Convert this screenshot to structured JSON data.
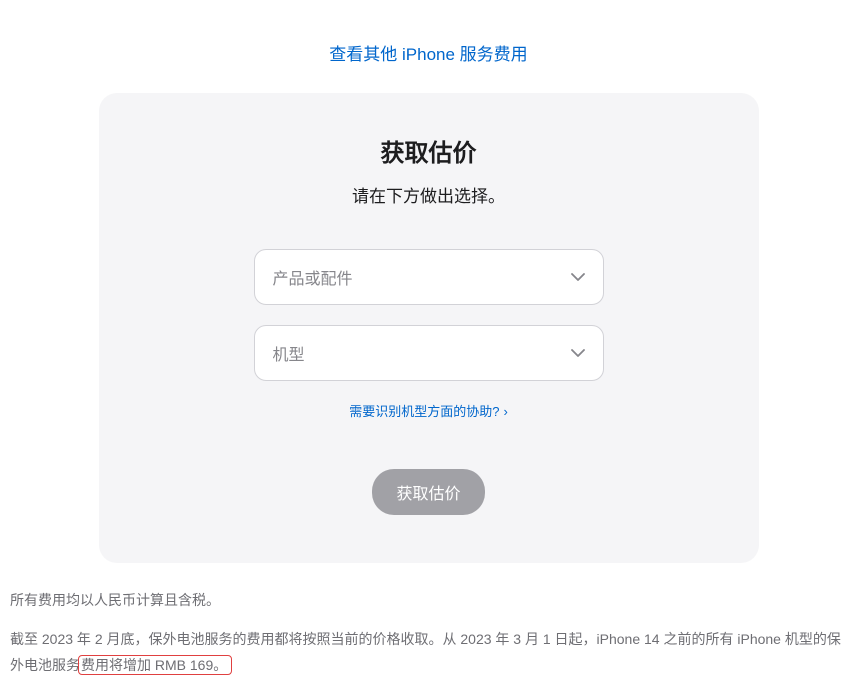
{
  "topLink": {
    "label": "查看其他 iPhone 服务费用"
  },
  "estimateCard": {
    "title": "获取估价",
    "subtitle": "请在下方做出选择。",
    "productSelect": {
      "placeholder": "产品或配件"
    },
    "modelSelect": {
      "placeholder": "机型"
    },
    "helpLink": {
      "label": "需要识别机型方面的协助?"
    },
    "submitButton": {
      "label": "获取估价"
    }
  },
  "footer": {
    "line1": "所有费用均以人民币计算且含税。",
    "line2_part1": "截至 2023 年 2 月底，保外电池服务的费用都将按照当前的价格收取。从 2023 年 3 月 1 日起，iPhone 14 之前的所有 iPhone 机型的保外电池服务",
    "line2_highlighted": "费用将增加 RMB 169。"
  }
}
